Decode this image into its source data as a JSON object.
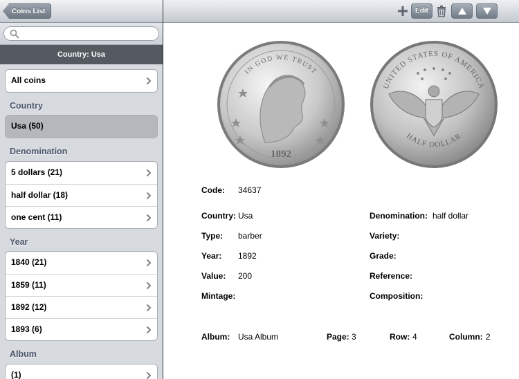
{
  "sidebar": {
    "back_label": "Coins List",
    "search": {
      "placeholder": "",
      "value": ""
    },
    "filter_label": "Country: Usa",
    "all_coins": "All coins",
    "sections": [
      {
        "header": "Country",
        "items": [
          "Usa (50)"
        ]
      },
      {
        "header": "Denomination",
        "items": [
          "5 dollars (21)",
          "half dollar (18)",
          "one cent (11)"
        ]
      },
      {
        "header": "Year",
        "items": [
          "1840 (21)",
          "1859 (11)",
          "1892 (12)",
          "1893 (6)"
        ]
      },
      {
        "header": "Album",
        "items": [
          "(1)"
        ]
      }
    ]
  },
  "toolbar": {
    "edit_label": "Edit"
  },
  "coin": {
    "obverse": {
      "inscription": "IN GOD WE TRUST",
      "year": "1892"
    },
    "reverse": {
      "inscription_top": "UNITED STATES OF AMERICA",
      "inscription_bottom": "HALF DOLLAR"
    }
  },
  "details": {
    "code_label": "Code:",
    "code": "34637",
    "country_label": "Country:",
    "country": "Usa",
    "type_label": "Type:",
    "type": "barber",
    "year_label": "Year:",
    "year": "1892",
    "value_label": "Value:",
    "value": "200",
    "mintage_label": "Mintage:",
    "mintage": "",
    "denomination_label": "Denomination:",
    "denomination": "half dollar",
    "variety_label": "Variety:",
    "variety": "",
    "grade_label": "Grade:",
    "grade": "",
    "reference_label": "Reference:",
    "reference": "",
    "composition_label": "Composition:",
    "composition": "",
    "album_label": "Album:",
    "album": "Usa Album",
    "page_label": "Page:",
    "page": "3",
    "row_label": "Row:",
    "row": "4",
    "column_label": "Column:",
    "column": "2"
  },
  "colors": {
    "filter_bar": "#545a60",
    "section_header": "#4c566c",
    "sidebar_bg": "#d7dadf"
  }
}
